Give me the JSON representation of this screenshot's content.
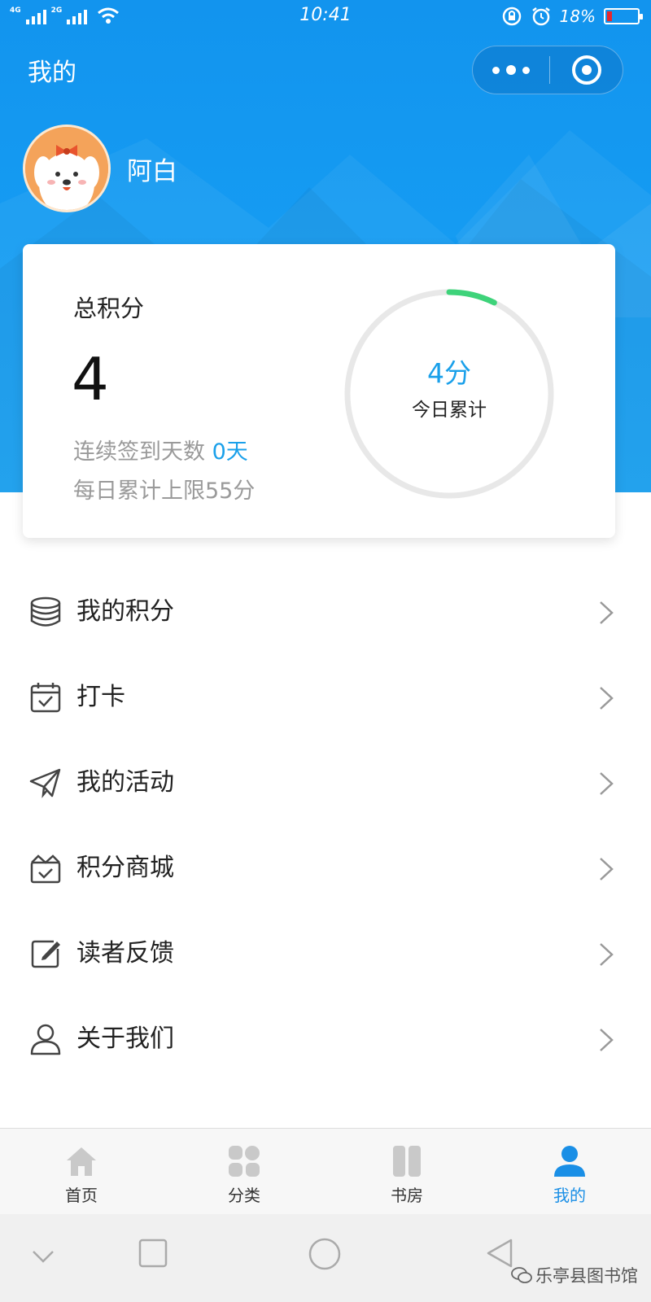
{
  "status_bar": {
    "network_1": "4G",
    "network_2": "2G",
    "time": "10:41",
    "battery": "18%",
    "battery_level": 0.18
  },
  "header": {
    "title": "我的"
  },
  "profile": {
    "name": "阿白"
  },
  "score_card": {
    "label": "总积分",
    "total": "4",
    "streak_label": "连续签到天数",
    "streak_value": "0天",
    "daily_limit": "每日累计上限55分",
    "today_value": "4分",
    "today_label": "今日累计",
    "today_progress": 0.073,
    "colors": {
      "accent": "#1aa0ea",
      "progress": "#3ed37a",
      "track": "#e8e8e8"
    }
  },
  "menu": {
    "items": [
      {
        "icon": "coins-stack-icon",
        "label": "我的积分"
      },
      {
        "icon": "calendar-check-icon",
        "label": "打卡"
      },
      {
        "icon": "paper-plane-icon",
        "label": "我的活动"
      },
      {
        "icon": "gift-box-icon",
        "label": "积分商城"
      },
      {
        "icon": "edit-square-icon",
        "label": "读者反馈"
      },
      {
        "icon": "user-outline-icon",
        "label": "关于我们"
      }
    ]
  },
  "tabbar": {
    "tabs": [
      {
        "icon": "home-icon",
        "label": "首页",
        "active": false
      },
      {
        "icon": "category-grid-icon",
        "label": "分类",
        "active": false
      },
      {
        "icon": "bookshelf-icon",
        "label": "书房",
        "active": false
      },
      {
        "icon": "profile-icon",
        "label": "我的",
        "active": true
      }
    ]
  },
  "watermark": {
    "text": "乐亭县图书馆"
  }
}
